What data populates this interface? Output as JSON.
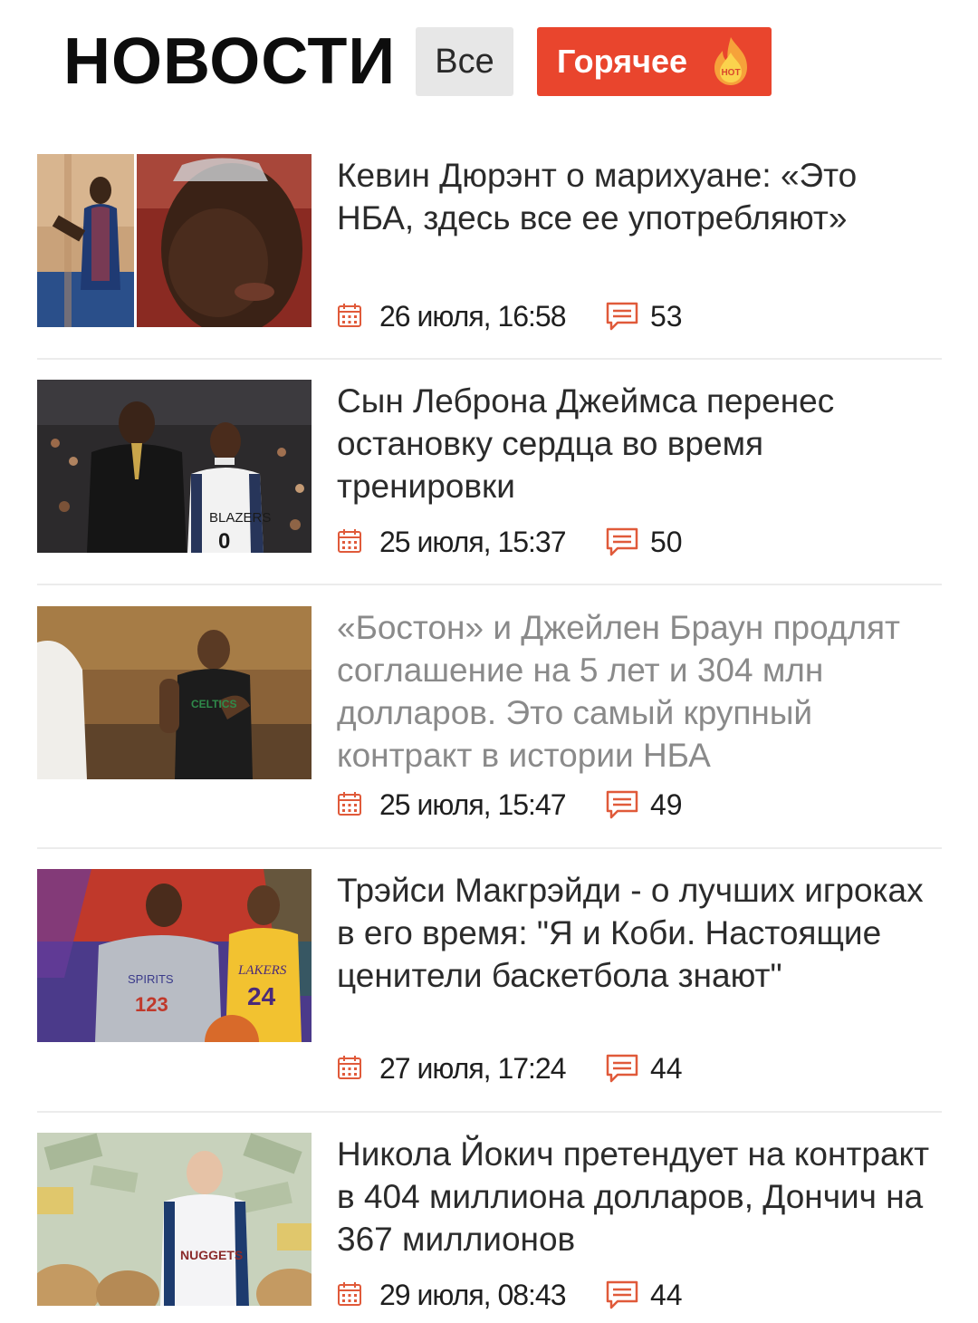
{
  "header": {
    "title": "НОВОСТИ",
    "filter_all": "Все",
    "filter_hot": "Горячее",
    "hot_badge": "HOT"
  },
  "news": [
    {
      "title": "Кевин Дюрэнт о марихуане: «Это НБА, здесь все ее употребляют»",
      "date": "26 июля, 16:58",
      "comments": "53",
      "read": false
    },
    {
      "title": "Сын Леброна Джеймса перенес остановку сердца во время тренировки",
      "date": "25 июля, 15:37",
      "comments": "50",
      "read": false
    },
    {
      "title": "«Бостон» и Джейлен Браун продлят соглашение на 5 лет и 304 млн долларов. Это самый крупный контракт в истории НБА",
      "date": "25 июля, 15:47",
      "comments": "49",
      "read": true
    },
    {
      "title": "Трэйси Макгрэйди - о лучших игроках в его время: \"Я и Коби. Настоящие ценители баскетбола знают\"",
      "date": "27 июля, 17:24",
      "comments": "44",
      "read": false
    },
    {
      "title": "Никола Йокич претендует на контракт в 404 миллиона долларов, Дончич на 367 миллионов",
      "date": "29 июля, 08:43",
      "comments": "44",
      "read": false
    }
  ],
  "thumb_text": {
    "jersey_1": "BLAZERS",
    "jersey_1_num": "0",
    "jersey_2": "CELTICS",
    "shirt_3": "SPIRITS",
    "shirt_3_num": "123",
    "jersey_3": "LAKERS",
    "jersey_3_num": "24",
    "jersey_4": "NUGGETS"
  },
  "colors": {
    "accent": "#e9452d",
    "icon": "#e05a3a",
    "text": "#2b2b2b",
    "read_text": "#8a8a8a"
  },
  "icons": {
    "date": "calendar-icon",
    "comments": "comment-icon",
    "hot": "flame-icon"
  }
}
